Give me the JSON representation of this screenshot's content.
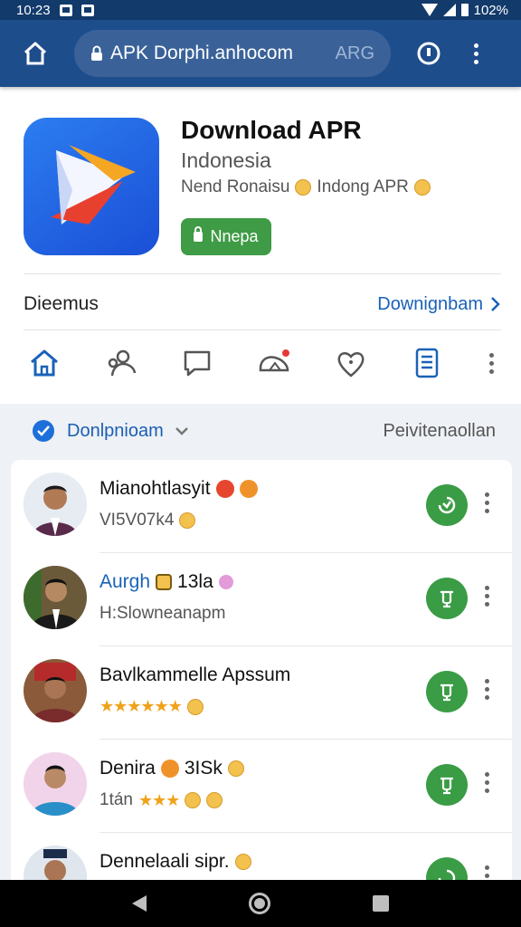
{
  "status_bar": {
    "time": "10:23",
    "battery": "102%"
  },
  "browser": {
    "url": "APK Dorphi.anhocom",
    "url_tail": "ARG"
  },
  "app": {
    "title": "Download APR",
    "subtitle": "Indonesia",
    "meta_left": "Nend Ronaisu",
    "meta_right": "Indong APR",
    "install_label": "Nnepa"
  },
  "section": {
    "title": "Dieemus",
    "link": "Downignbam"
  },
  "icon_row": [
    "home-icon",
    "people-icon",
    "chat-icon",
    "notification-icon",
    "heart-icon",
    "document-icon"
  ],
  "filter": {
    "label": "Donlpnioam",
    "right": "Peivitenaollan"
  },
  "list": [
    {
      "name": "Mianohtlasyit",
      "sub": "VI5V07k4",
      "link": false
    },
    {
      "name": "Aurgh",
      "extra": "13la",
      "sub": "H:Slowneanapm",
      "link": true
    },
    {
      "name": "Bavlkammelle Apssum",
      "stars": "★★★★★★",
      "link": false
    },
    {
      "name": "Denira",
      "extra": "3ISk",
      "sub": "1tán",
      "stars": "★★★",
      "link": false
    },
    {
      "name": "Dennelaali sipr.",
      "link": false
    }
  ],
  "colors": {
    "header": "#1e4d8c",
    "accent": "#1a62b8",
    "install_green": "#3f9b45",
    "action_green": "#3a9c45"
  }
}
